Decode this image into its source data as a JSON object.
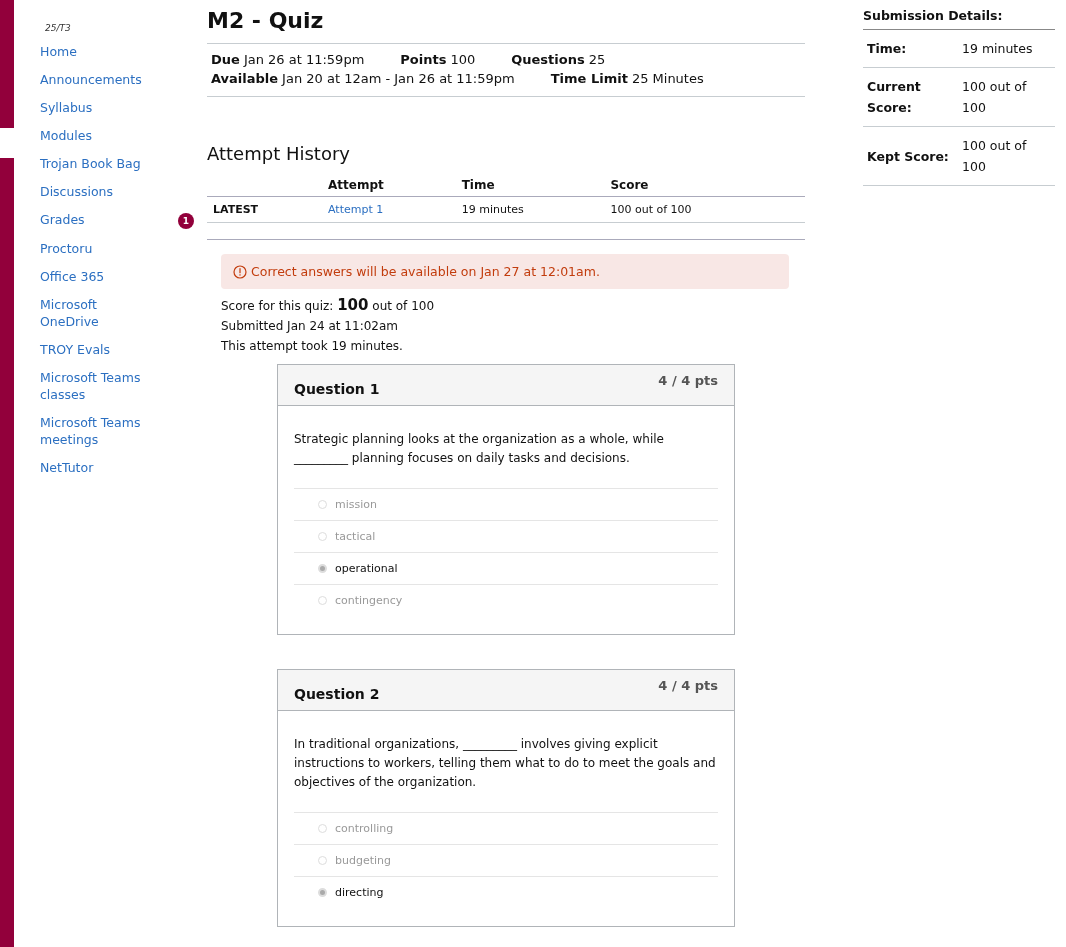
{
  "course_nav": {
    "term": "25/T3",
    "items": [
      {
        "label": "Home"
      },
      {
        "label": "Announcements"
      },
      {
        "label": "Syllabus"
      },
      {
        "label": "Modules"
      },
      {
        "label": "Trojan Book Bag"
      },
      {
        "label": "Discussions"
      },
      {
        "label": "Grades",
        "badge": "1"
      },
      {
        "label": "Proctoru"
      },
      {
        "label": "Office 365"
      },
      {
        "label": "Microsoft OneDrive"
      },
      {
        "label": "TROY Evals"
      },
      {
        "label": "Microsoft Teams classes"
      },
      {
        "label": "Microsoft Teams meetings"
      },
      {
        "label": "NetTutor"
      }
    ]
  },
  "quiz": {
    "title": "M2 - Quiz",
    "details": [
      [
        {
          "label": "Due",
          "value": "Jan 26 at 11:59pm"
        },
        {
          "label": "Points",
          "value": "100"
        },
        {
          "label": "Questions",
          "value": "25"
        }
      ],
      [
        {
          "label": "Available",
          "value": "Jan 20 at 12am - Jan 26 at 11:59pm"
        },
        {
          "label": "Time Limit",
          "value": "25 Minutes"
        }
      ]
    ]
  },
  "attempt_history": {
    "title": "Attempt History",
    "columns": [
      "Attempt",
      "Time",
      "Score"
    ],
    "rows": [
      {
        "tag": "LATEST",
        "attempt": "Attempt 1",
        "time": "19 minutes",
        "score": "100 out of 100"
      }
    ]
  },
  "notice": "Correct answers will be available on Jan 27 at 12:01am.",
  "result": {
    "score_line": "Score for this quiz: **100** out of 100",
    "submitted": "Submitted Jan 24 at 11:02am",
    "duration": "This attempt took 19 minutes."
  },
  "questions": [
    {
      "title": "Question 1",
      "points": "4 / 4 pts",
      "text": "Strategic planning looks at the organization as a whole, while _________ planning focuses on daily tasks and decisions.",
      "answers": [
        {
          "label": "mission",
          "selected": false
        },
        {
          "label": "tactical",
          "selected": false
        },
        {
          "label": "operational",
          "selected": true
        },
        {
          "label": "contingency",
          "selected": false
        }
      ]
    },
    {
      "title": "Question 2",
      "points": "4 / 4 pts",
      "text": "In traditional organizations, _________ involves giving explicit instructions to workers, telling them what to do to meet the goals and objectives of the organization.",
      "answers": [
        {
          "label": "controlling",
          "selected": false
        },
        {
          "label": "budgeting",
          "selected": false
        },
        {
          "label": "directing",
          "selected": true
        }
      ]
    }
  ],
  "submission_details": {
    "title": "Submission Details:",
    "rows": [
      {
        "label": "Time:",
        "value": "19 minutes"
      },
      {
        "label": "Current Score:",
        "value": "100 out of 100"
      },
      {
        "label": "Kept Score:",
        "value": "100 out of 100"
      }
    ]
  }
}
